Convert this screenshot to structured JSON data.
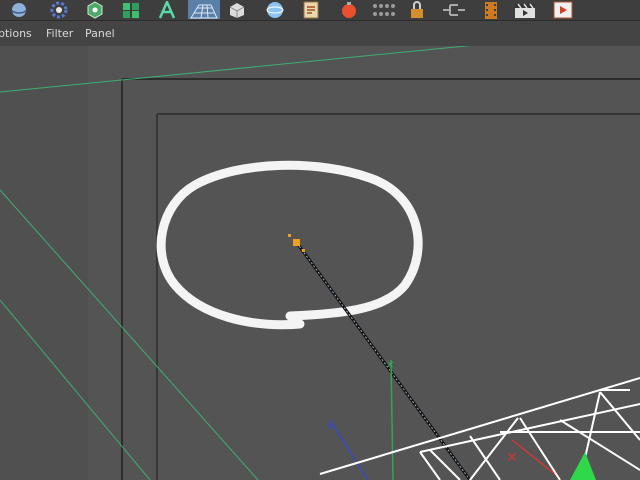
{
  "toolbar": {
    "icons": [
      "sphere-object-icon",
      "gear-deformer-icon",
      "hexagon-cube-icon",
      "mograph-cloner-icon",
      "lathe-spline-icon",
      "floor-plane-icon",
      "cube-primitive-icon",
      "globe-environment-icon",
      "script-document-icon",
      "material-ball-icon",
      "dots-grid-icon",
      "lock-icon",
      "node-graph-icon",
      "film-strip-icon",
      "clapperboard-icon",
      "render-picture-icon"
    ],
    "active_icon": "floor-plane-icon"
  },
  "menu": {
    "items": [
      {
        "label": "ptions"
      },
      {
        "label": "Filter"
      },
      {
        "label": "Panel"
      }
    ]
  },
  "viewport": {
    "background_color": "#545454",
    "frame_color": "#2f2f2f",
    "horizon_color": "#3fae74",
    "selected_point_color": "#f0a020",
    "annotation_color": "#ffffff"
  }
}
